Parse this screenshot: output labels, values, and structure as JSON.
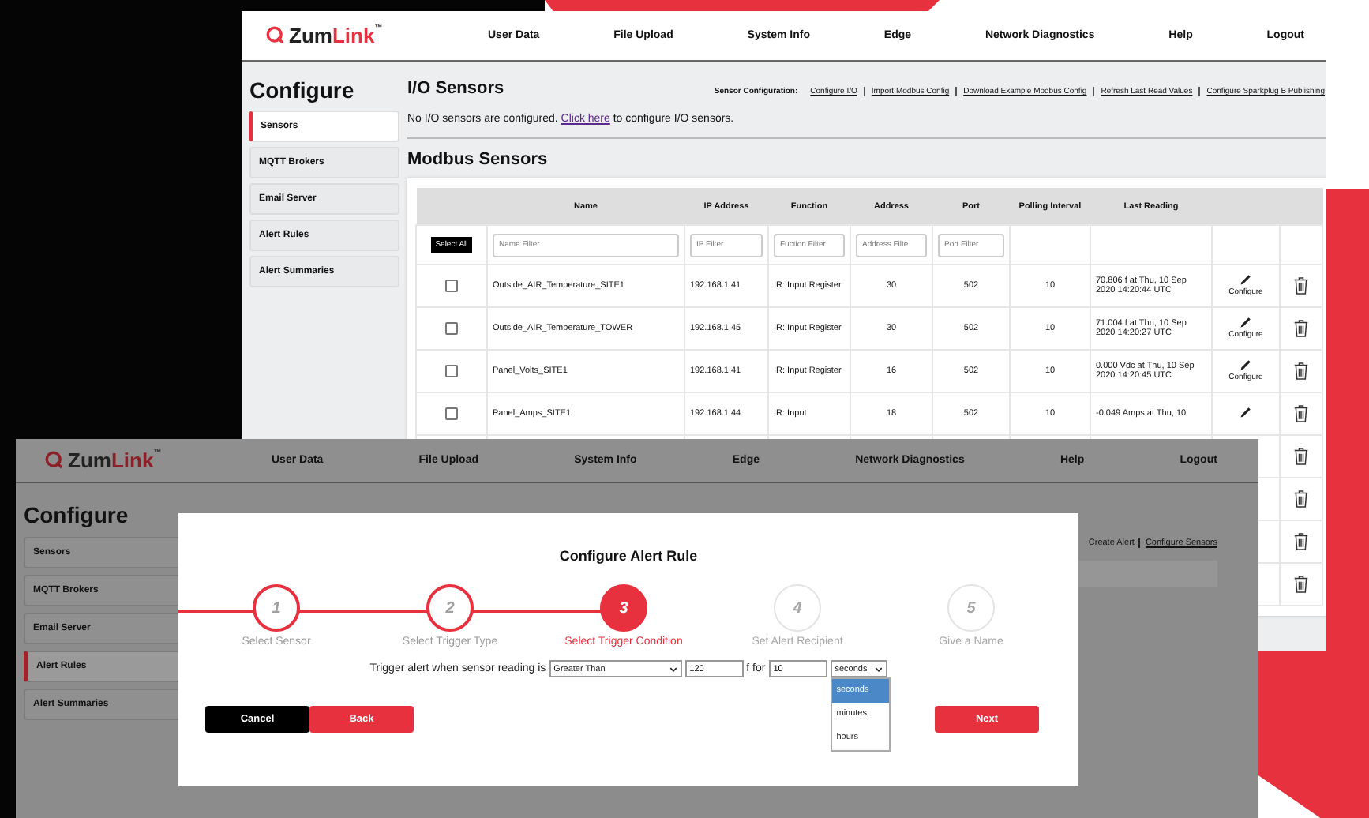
{
  "back_window": {
    "logo": {
      "text_dark": "Zum",
      "text_red": "Link",
      "trademark": "™"
    },
    "nav": [
      "User Data",
      "File Upload",
      "System Info",
      "Edge",
      "Network Diagnostics",
      "Help",
      "Logout"
    ],
    "sidebar": {
      "title": "Configure",
      "items": [
        {
          "label": "Sensors",
          "selected": true
        },
        {
          "label": "MQTT Brokers",
          "selected": false
        },
        {
          "label": "Email Server",
          "selected": false
        },
        {
          "label": "Alert Rules",
          "selected": false
        },
        {
          "label": "Alert Summaries",
          "selected": false
        }
      ]
    },
    "io_sensors": {
      "title": "I/O Sensors",
      "config_label": "Sensor Configuration:",
      "config_links": [
        "Configure I/O",
        "Import Modbus Config",
        "Download Example Modbus Config",
        "Refresh Last Read Values",
        "Configure Sparkplug B Publishing"
      ],
      "message": {
        "before": "No I/O sensors are configured.",
        "link": "Click here",
        "after": "to configure I/O sensors."
      }
    },
    "modbus_sensors": {
      "title": "Modbus Sensors",
      "table": {
        "columns": [
          "Name",
          "IP Address",
          "Function",
          "Address",
          "Port",
          "Polling Interval",
          "Last Reading"
        ],
        "select_all": "Select All",
        "filters": [
          {
            "placeholder": "Name Filter"
          },
          {
            "placeholder": "IP Filter"
          },
          {
            "placeholder": "Fuction Filter"
          },
          {
            "placeholder": "Address Filte"
          },
          {
            "placeholder": "Port Filter"
          }
        ],
        "rows": [
          {
            "kind": "full",
            "checked": false,
            "name": "Outside_AIR_Temperature_SITE1",
            "ip": "192.168.1.41",
            "function": "IR: Input Register",
            "address": "30",
            "port": "502",
            "polling": "10",
            "reading": "70.806 f at Thu, 10 Sep 2020 14:20:44 UTC",
            "action": "Configure"
          },
          {
            "kind": "full",
            "checked": false,
            "name": "Outside_AIR_Temperature_TOWER",
            "ip": "192.168.1.45",
            "function": "IR: Input Register",
            "address": "30",
            "port": "502",
            "polling": "10",
            "reading": "71.004 f at Thu, 10 Sep 2020 14:20:27 UTC",
            "action": "Configure"
          },
          {
            "kind": "full",
            "checked": false,
            "name": "Panel_Volts_SITE1",
            "ip": "192.168.1.41",
            "function": "IR: Input Register",
            "address": "16",
            "port": "502",
            "polling": "10",
            "reading": "0.000 Vdc at Thu, 10 Sep 2020 14:20:45 UTC",
            "action": "Configure"
          },
          {
            "kind": "full",
            "checked": false,
            "name": "Panel_Amps_SITE1",
            "ip": "192.168.1.44",
            "function": "IR: Input",
            "address": "18",
            "port": "502",
            "polling": "10",
            "reading": "-0.049 Amps at Thu, 10"
          },
          {
            "kind": "covered"
          },
          {
            "kind": "covered"
          },
          {
            "kind": "covered"
          },
          {
            "kind": "covered"
          }
        ]
      }
    }
  },
  "front_window": {
    "logo": {
      "text_dark": "Zum",
      "text_red": "Link",
      "trademark": "™"
    },
    "nav": [
      "User Data",
      "File Upload",
      "System Info",
      "Edge",
      "Network Diagnostics",
      "Help",
      "Logout"
    ],
    "sidebar": {
      "title": "Configure",
      "items": [
        {
          "label": "Sensors",
          "selected": false
        },
        {
          "label": "MQTT Brokers",
          "selected": false
        },
        {
          "label": "Email Server",
          "selected": false
        },
        {
          "label": "Alert Rules",
          "selected": true
        },
        {
          "label": "Alert Summaries",
          "selected": false
        }
      ]
    },
    "links": {
      "create": "Create Alert",
      "configure": "Configure Sensors"
    },
    "modal": {
      "title": "Configure Alert Rule",
      "steps": [
        {
          "number": "1",
          "label": "Select Sensor",
          "completed": true,
          "selected": false
        },
        {
          "number": "2",
          "label": "Select Trigger Type",
          "completed": true,
          "selected": false
        },
        {
          "number": "3",
          "label": "Select Trigger Condition",
          "completed": false,
          "selected": true
        },
        {
          "number": "4",
          "label": "Set Alert Recipient",
          "completed": false,
          "selected": false
        },
        {
          "number": "5",
          "label": "Give a Name",
          "completed": false,
          "selected": false
        }
      ],
      "condition": {
        "prefix": "Trigger alert when sensor reading is",
        "operator": "Greater Than",
        "threshold": "120",
        "unit_text": "f for",
        "duration": "10",
        "duration_unit": {
          "value": "seconds",
          "expanded": true,
          "options": [
            {
              "label": "seconds",
              "selected": true
            },
            {
              "label": "minutes",
              "selected": false
            },
            {
              "label": "hours",
              "selected": false
            }
          ]
        }
      },
      "buttons": [
        {
          "label": "Cancel",
          "kind": "secondary"
        },
        {
          "label": "Back",
          "kind": "primary"
        },
        {
          "label": "Next",
          "kind": "primary"
        }
      ]
    }
  }
}
